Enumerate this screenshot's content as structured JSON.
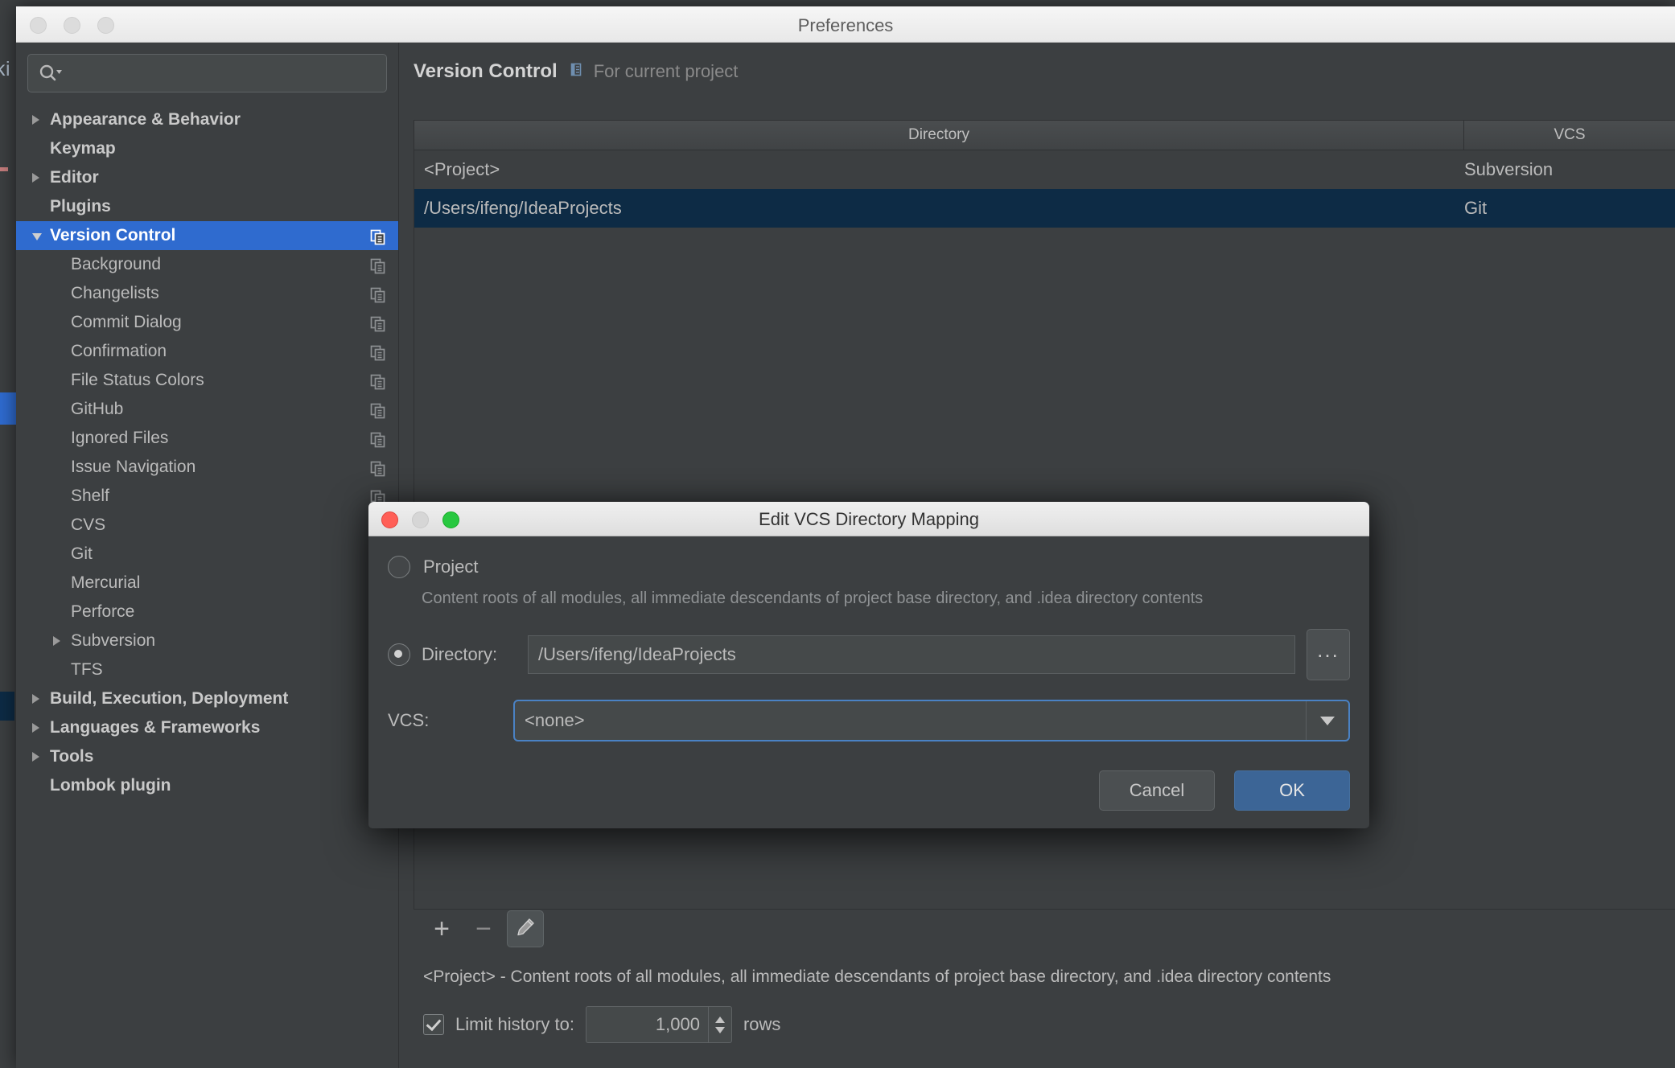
{
  "window": {
    "title": "Preferences",
    "traffic_lights": [
      "close",
      "minimize",
      "zoom"
    ]
  },
  "background": {
    "editor_fragment": "ki"
  },
  "sidebar": {
    "search": {
      "value": "",
      "placeholder": "",
      "icon": "search-icon"
    },
    "items": [
      {
        "label": "Appearance & Behavior",
        "arrow": "right",
        "bold": true,
        "indent": 0,
        "scope_icon": false,
        "selected": false
      },
      {
        "label": "Keymap",
        "arrow": "none",
        "bold": true,
        "indent": 0,
        "scope_icon": false,
        "selected": false
      },
      {
        "label": "Editor",
        "arrow": "right",
        "bold": true,
        "indent": 0,
        "scope_icon": false,
        "selected": false
      },
      {
        "label": "Plugins",
        "arrow": "none",
        "bold": true,
        "indent": 0,
        "scope_icon": false,
        "selected": false
      },
      {
        "label": "Version Control",
        "arrow": "down",
        "bold": true,
        "indent": 0,
        "scope_icon": true,
        "selected": true
      },
      {
        "label": "Background",
        "arrow": "none",
        "bold": false,
        "indent": 1,
        "scope_icon": true,
        "selected": false
      },
      {
        "label": "Changelists",
        "arrow": "none",
        "bold": false,
        "indent": 1,
        "scope_icon": true,
        "selected": false
      },
      {
        "label": "Commit Dialog",
        "arrow": "none",
        "bold": false,
        "indent": 1,
        "scope_icon": true,
        "selected": false
      },
      {
        "label": "Confirmation",
        "arrow": "none",
        "bold": false,
        "indent": 1,
        "scope_icon": true,
        "selected": false
      },
      {
        "label": "File Status Colors",
        "arrow": "none",
        "bold": false,
        "indent": 1,
        "scope_icon": true,
        "selected": false
      },
      {
        "label": "GitHub",
        "arrow": "none",
        "bold": false,
        "indent": 1,
        "scope_icon": true,
        "selected": false
      },
      {
        "label": "Ignored Files",
        "arrow": "none",
        "bold": false,
        "indent": 1,
        "scope_icon": true,
        "selected": false
      },
      {
        "label": "Issue Navigation",
        "arrow": "none",
        "bold": false,
        "indent": 1,
        "scope_icon": true,
        "selected": false
      },
      {
        "label": "Shelf",
        "arrow": "none",
        "bold": false,
        "indent": 1,
        "scope_icon": true,
        "selected": false
      },
      {
        "label": "CVS",
        "arrow": "none",
        "bold": false,
        "indent": 1,
        "scope_icon": true,
        "selected": false
      },
      {
        "label": "Git",
        "arrow": "none",
        "bold": false,
        "indent": 1,
        "scope_icon": true,
        "selected": false
      },
      {
        "label": "Mercurial",
        "arrow": "none",
        "bold": false,
        "indent": 1,
        "scope_icon": true,
        "selected": false
      },
      {
        "label": "Perforce",
        "arrow": "none",
        "bold": false,
        "indent": 1,
        "scope_icon": true,
        "selected": false
      },
      {
        "label": "Subversion",
        "arrow": "right",
        "bold": false,
        "indent": 1,
        "scope_icon": true,
        "selected": false
      },
      {
        "label": "TFS",
        "arrow": "none",
        "bold": false,
        "indent": 1,
        "scope_icon": true,
        "selected": false
      },
      {
        "label": "Build, Execution, Deployment",
        "arrow": "right",
        "bold": true,
        "indent": 0,
        "scope_icon": false,
        "selected": false
      },
      {
        "label": "Languages & Frameworks",
        "arrow": "right",
        "bold": true,
        "indent": 0,
        "scope_icon": false,
        "selected": false
      },
      {
        "label": "Tools",
        "arrow": "right",
        "bold": true,
        "indent": 0,
        "scope_icon": false,
        "selected": false
      },
      {
        "label": "Lombok plugin",
        "arrow": "none",
        "bold": true,
        "indent": 0,
        "scope_icon": true,
        "selected": false
      }
    ]
  },
  "main": {
    "title": "Version Control",
    "scope_note": "For current project",
    "table": {
      "columns": [
        "Directory",
        "VCS"
      ],
      "rows": [
        {
          "directory": "<Project>",
          "vcs": "Subversion",
          "selected": false
        },
        {
          "directory": "/Users/ifeng/IdeaProjects",
          "vcs": "Git",
          "selected": true
        }
      ]
    },
    "toolbar": {
      "add_label": "+",
      "remove_label": "−",
      "edit_icon": "pencil-icon"
    },
    "footer_note": "<Project> - Content roots of all modules, all immediate descendants of project base directory, and .idea directory contents",
    "limit_history": {
      "checked": true,
      "label": "Limit history to:",
      "value": "1,000",
      "suffix": "rows"
    }
  },
  "dialog": {
    "title": "Edit VCS Directory Mapping",
    "project_radio": {
      "label": "Project",
      "checked": false
    },
    "project_description": "Content roots of all modules, all immediate descendants of project base directory, and .idea directory contents",
    "directory_radio": {
      "label": "Directory:",
      "checked": true
    },
    "directory_value": "/Users/ifeng/IdeaProjects",
    "browse_label": "...",
    "vcs_label": "VCS:",
    "vcs_value": "<none>",
    "cancel_label": "Cancel",
    "ok_label": "OK"
  },
  "colors": {
    "selection_blue": "#2f6bcf",
    "row_selection_navy": "#0d2b45",
    "panel_bg": "#3c3f41",
    "focus_border": "#4a82c4",
    "primary_button": "#3c6596"
  }
}
